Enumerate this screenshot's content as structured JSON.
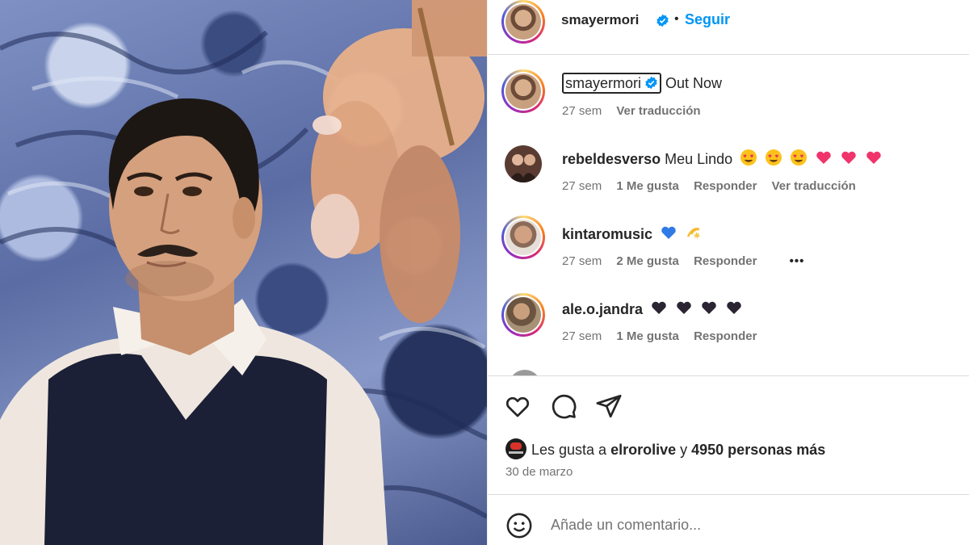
{
  "post": {
    "author": "smayermori",
    "follow_label": "Seguir",
    "separator": "•",
    "caption_user": "smayermori",
    "caption_text": "Out Now",
    "caption_time": "27 sem",
    "caption_translate": "Ver traducción"
  },
  "comments": [
    {
      "user": "rebeldesverso",
      "text": "Meu Lindo",
      "emojis": [
        "heart-eyes",
        "heart-eyes",
        "heart-eyes",
        "pink-heart",
        "pink-heart",
        "pink-heart"
      ],
      "time": "27 sem",
      "likes": "1 Me gusta",
      "reply": "Responder",
      "translate": "Ver traducción"
    },
    {
      "user": "kintaromusic",
      "text": "",
      "emojis": [
        "blue-heart",
        "dizzy"
      ],
      "time": "27 sem",
      "likes": "2 Me gusta",
      "reply": "Responder",
      "more": "•••"
    },
    {
      "user": "ale.o.jandra",
      "text": "",
      "emojis": [
        "black-heart",
        "black-heart",
        "black-heart",
        "black-heart"
      ],
      "time": "27 sem",
      "likes": "1 Me gusta",
      "reply": "Responder"
    }
  ],
  "likes_line": {
    "prefix": "Les gusta a ",
    "user": "elrorolive",
    "joiner": " y ",
    "count": "4950 personas más"
  },
  "date": "30 de marzo",
  "add_comment_placeholder": "Añade un comentario...",
  "icons": [
    "heart-icon",
    "comment-icon",
    "share-icon",
    "emoji-icon",
    "verified-icon"
  ],
  "colors": {
    "follow": "#0095f6",
    "verified": "#0095f6",
    "muted": "#737373",
    "text": "#262626"
  }
}
